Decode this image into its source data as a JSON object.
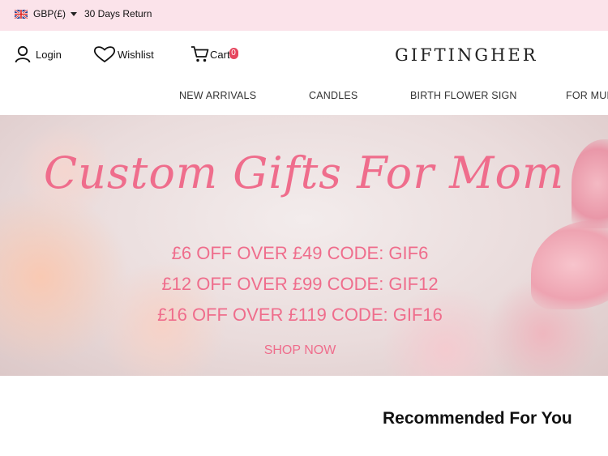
{
  "topbar": {
    "currency": "GBP(£)",
    "returns": "30 Days Return"
  },
  "header": {
    "login": "Login",
    "wishlist": "Wishlist",
    "cart": "Cart",
    "cart_count": "0",
    "logo": "GIFTINGHER"
  },
  "nav": {
    "items": [
      "NEW ARRIVALS",
      "CANDLES",
      "BIRTH FLOWER SIGN",
      "FOR MUM"
    ]
  },
  "hero": {
    "title": "Custom Gifts For Mom",
    "promos": [
      "£6 OFF OVER £49 CODE: GIF6",
      "£12 OFF OVER £99 CODE: GIF12",
      "£16 OFF OVER £119 CODE: GIF16"
    ],
    "cta": "SHOP NOW"
  },
  "section": {
    "title": "Recommended For You"
  },
  "colors": {
    "accent": "#ef6d8c",
    "topbar": "#fbe3ea",
    "badge": "#e6475f"
  },
  "icons": [
    "uk-flag-icon",
    "caret-down-icon",
    "user-icon",
    "heart-icon",
    "cart-icon"
  ]
}
